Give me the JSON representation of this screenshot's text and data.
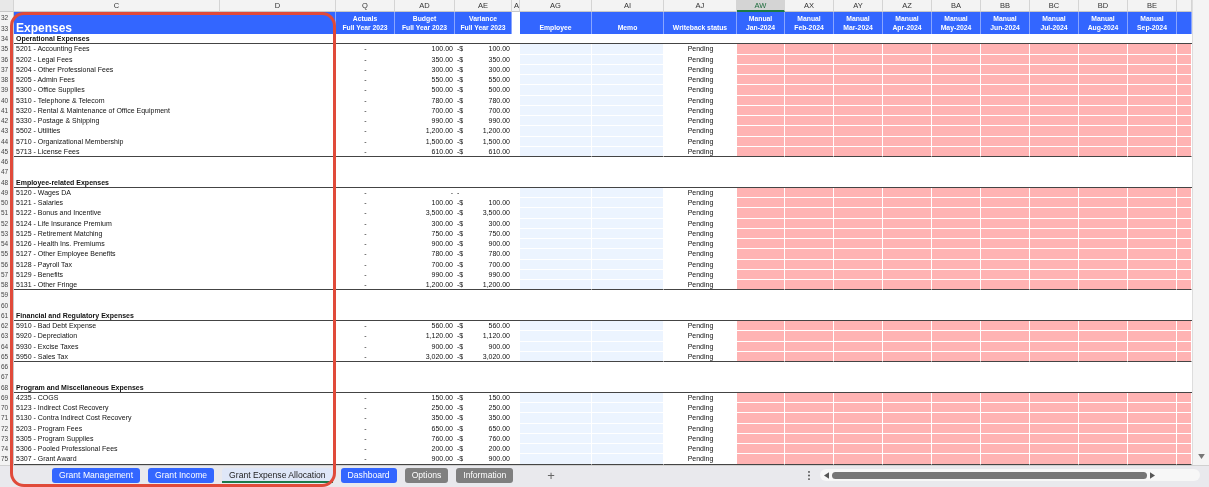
{
  "column_headers": [
    {
      "label": "C",
      "selected": false
    },
    {
      "label": "D",
      "selected": false
    },
    {
      "label": "Q",
      "selected": false
    },
    {
      "label": "AD",
      "selected": false
    },
    {
      "label": "AE",
      "selected": false
    },
    {
      "label": "A",
      "selected": false
    },
    {
      "label": "AG",
      "selected": false
    },
    {
      "label": "AI",
      "selected": false
    },
    {
      "label": "AJ",
      "selected": false
    },
    {
      "label": "AW",
      "selected": true
    },
    {
      "label": "AX",
      "selected": false
    },
    {
      "label": "AY",
      "selected": false
    },
    {
      "label": "AZ",
      "selected": false
    },
    {
      "label": "BA",
      "selected": false
    },
    {
      "label": "BB",
      "selected": false
    },
    {
      "label": "BC",
      "selected": false
    },
    {
      "label": "BD",
      "selected": false
    },
    {
      "label": "BE",
      "selected": false
    }
  ],
  "header": {
    "rows": [
      "32",
      "33"
    ],
    "title": "Expenses",
    "amount_columns": [
      {
        "line1": "Actuals",
        "line2": "Full Year 2023"
      },
      {
        "line1": "Budget",
        "line2": "Full Year 2023"
      },
      {
        "line1": "Variance",
        "line2": "Full Year 2023"
      }
    ],
    "input_columns": [
      "Employee",
      "Memo",
      "Writeback status"
    ],
    "month_columns": [
      {
        "line1": "Manual",
        "line2": "Jan-2024"
      },
      {
        "line1": "Manual",
        "line2": "Feb-2024"
      },
      {
        "line1": "Manual",
        "line2": "Mar-2024"
      },
      {
        "line1": "Manual",
        "line2": "Apr-2024"
      },
      {
        "line1": "Manual",
        "line2": "May-2024"
      },
      {
        "line1": "Manual",
        "line2": "Jun-2024"
      },
      {
        "line1": "Manual",
        "line2": "Jul-2024"
      },
      {
        "line1": "Manual",
        "line2": "Aug-2024"
      },
      {
        "line1": "Manual",
        "line2": "Sep-2024"
      }
    ]
  },
  "sections": [
    {
      "row": "34",
      "title": "Operational Expenses",
      "items": [
        {
          "row": "35",
          "account": "5201 - Accounting Fees",
          "actuals": "-",
          "budget": "100.00",
          "variance_sign": "-$",
          "variance": "100.00",
          "status": "Pending"
        },
        {
          "row": "36",
          "account": "5202 - Legal Fees",
          "actuals": "-",
          "budget": "350.00",
          "variance_sign": "-$",
          "variance": "350.00",
          "status": "Pending"
        },
        {
          "row": "37",
          "account": "5204 - Other Professional Fees",
          "actuals": "-",
          "budget": "300.00",
          "variance_sign": "-$",
          "variance": "300.00",
          "status": "Pending"
        },
        {
          "row": "38",
          "account": "5205 - Admin Fees",
          "actuals": "-",
          "budget": "550.00",
          "variance_sign": "-$",
          "variance": "550.00",
          "status": "Pending"
        },
        {
          "row": "39",
          "account": "5300 - Office Supplies",
          "actuals": "-",
          "budget": "500.00",
          "variance_sign": "-$",
          "variance": "500.00",
          "status": "Pending"
        },
        {
          "row": "40",
          "account": "5310 - Telephone & Telecom",
          "actuals": "-",
          "budget": "780.00",
          "variance_sign": "-$",
          "variance": "780.00",
          "status": "Pending"
        },
        {
          "row": "41",
          "account": "5320 - Rental & Maintenance of Office Equipment",
          "actuals": "-",
          "budget": "700.00",
          "variance_sign": "-$",
          "variance": "700.00",
          "status": "Pending"
        },
        {
          "row": "42",
          "account": "5330 - Postage & Shipping",
          "actuals": "-",
          "budget": "990.00",
          "variance_sign": "-$",
          "variance": "990.00",
          "status": "Pending"
        },
        {
          "row": "43",
          "account": "5502 - Utilities",
          "actuals": "-",
          "budget": "1,200.00",
          "variance_sign": "-$",
          "variance": "1,200.00",
          "status": "Pending"
        },
        {
          "row": "44",
          "account": "5710 - Organizational Membership",
          "actuals": "-",
          "budget": "1,500.00",
          "variance_sign": "-$",
          "variance": "1,500.00",
          "status": "Pending"
        },
        {
          "row": "45",
          "account": "5713 - License Fees",
          "actuals": "-",
          "budget": "610.00",
          "variance_sign": "-$",
          "variance": "610.00",
          "status": "Pending"
        }
      ],
      "blank_rows": [
        "46",
        "47"
      ]
    },
    {
      "row": "48",
      "title": "Employee-related Expenses",
      "items": [
        {
          "row": "49",
          "account": "5120 - Wages DA",
          "actuals": "-",
          "budget": "-",
          "variance": "-",
          "status": "Pending"
        },
        {
          "row": "50",
          "account": "5121 - Salaries",
          "actuals": "-",
          "budget": "100.00",
          "variance_sign": "-$",
          "variance": "100.00",
          "status": "Pending"
        },
        {
          "row": "51",
          "account": "5122 - Bonus and Incentive",
          "actuals": "-",
          "budget": "3,500.00",
          "variance_sign": "-$",
          "variance": "3,500.00",
          "status": "Pending"
        },
        {
          "row": "52",
          "account": "5124 - Life Insurance Premium",
          "actuals": "-",
          "budget": "300.00",
          "variance_sign": "-$",
          "variance": "300.00",
          "status": "Pending"
        },
        {
          "row": "53",
          "account": "5125 - Retirement Matching",
          "actuals": "-",
          "budget": "750.00",
          "variance_sign": "-$",
          "variance": "750.00",
          "status": "Pending"
        },
        {
          "row": "54",
          "account": "5126 - Health Ins. Premiums",
          "actuals": "-",
          "budget": "900.00",
          "variance_sign": "-$",
          "variance": "900.00",
          "status": "Pending"
        },
        {
          "row": "55",
          "account": "5127 - Other Employee Benefits",
          "actuals": "-",
          "budget": "780.00",
          "variance_sign": "-$",
          "variance": "780.00",
          "status": "Pending"
        },
        {
          "row": "56",
          "account": "5128 - Payroll Tax",
          "actuals": "-",
          "budget": "700.00",
          "variance_sign": "-$",
          "variance": "700.00",
          "status": "Pending"
        },
        {
          "row": "57",
          "account": "5129 - Benefits",
          "actuals": "-",
          "budget": "990.00",
          "variance_sign": "-$",
          "variance": "990.00",
          "status": "Pending"
        },
        {
          "row": "58",
          "account": "5131 - Other Fringe",
          "actuals": "-",
          "budget": "1,200.00",
          "variance_sign": "-$",
          "variance": "1,200.00",
          "status": "Pending"
        }
      ],
      "blank_rows": [
        "59",
        "60"
      ]
    },
    {
      "row": "61",
      "title": "Financial and Regulatory Expenses",
      "items": [
        {
          "row": "62",
          "account": "5910 - Bad Debt Expense",
          "actuals": "-",
          "budget": "560.00",
          "variance_sign": "-$",
          "variance": "560.00",
          "status": "Pending"
        },
        {
          "row": "63",
          "account": "5920 - Depreciation",
          "actuals": "-",
          "budget": "1,120.00",
          "variance_sign": "-$",
          "variance": "1,120.00",
          "status": "Pending"
        },
        {
          "row": "64",
          "account": "5930 - Excise Taxes",
          "actuals": "-",
          "budget": "900.00",
          "variance_sign": "-$",
          "variance": "900.00",
          "status": "Pending"
        },
        {
          "row": "65",
          "account": "5950 - Sales Tax",
          "actuals": "-",
          "budget": "3,020.00",
          "variance_sign": "-$",
          "variance": "3,020.00",
          "status": "Pending"
        }
      ],
      "blank_rows": [
        "66",
        "67"
      ]
    },
    {
      "row": "68",
      "title": "Program and Miscellaneous Expenses",
      "items": [
        {
          "row": "69",
          "account": "4235 - COGS",
          "actuals": "-",
          "budget": "150.00",
          "variance_sign": "-$",
          "variance": "150.00",
          "status": "Pending"
        },
        {
          "row": "70",
          "account": "5123 - Indirect Cost Recovery",
          "actuals": "-",
          "budget": "250.00",
          "variance_sign": "-$",
          "variance": "250.00",
          "status": "Pending"
        },
        {
          "row": "71",
          "account": "5130 - Contra Indirect Cost Recovery",
          "actuals": "-",
          "budget": "350.00",
          "variance_sign": "-$",
          "variance": "350.00",
          "status": "Pending"
        },
        {
          "row": "72",
          "account": "5203 - Program Fees",
          "actuals": "-",
          "budget": "650.00",
          "variance_sign": "-$",
          "variance": "650.00",
          "status": "Pending"
        },
        {
          "row": "73",
          "account": "5305 - Program Supplies",
          "actuals": "-",
          "budget": "760.00",
          "variance_sign": "-$",
          "variance": "760.00",
          "status": "Pending"
        },
        {
          "row": "74",
          "account": "5306 - Pooled Professional Fees",
          "actuals": "-",
          "budget": "200.00",
          "variance_sign": "-$",
          "variance": "200.00",
          "status": "Pending"
        },
        {
          "row": "75",
          "account": "5307 - Grant Award",
          "actuals": "-",
          "budget": "900.00",
          "variance_sign": "-$",
          "variance": "900.00",
          "status": "Pending"
        }
      ]
    }
  ],
  "sheet_tabs": [
    {
      "label": "Grant Management",
      "selected": false,
      "color": "#3366ff"
    },
    {
      "label": "Grant Income",
      "selected": false,
      "color": "#3366ff"
    },
    {
      "label": "Grant Expense Allocation",
      "selected": true,
      "color": "#dfe7f8"
    },
    {
      "label": "Dashboard",
      "selected": false,
      "color": "#3366ff"
    },
    {
      "label": "Options",
      "selected": false,
      "color": "#7f7f7f"
    },
    {
      "label": "Information",
      "selected": false,
      "color": "#7f7f7f"
    }
  ],
  "add_sheet": "+",
  "highlight_frame": true
}
